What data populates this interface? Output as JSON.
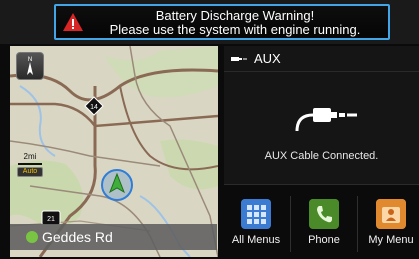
{
  "warning": {
    "line1": "Battery Discharge Warning!",
    "line2": "Please use the system with engine running."
  },
  "map": {
    "route_shield": "14",
    "route_shield_bottom": "21",
    "compass_label": "N",
    "scale": "2mi",
    "scale_mode": "Auto",
    "current_street": "Geddes Rd"
  },
  "aux": {
    "title": "AUX",
    "status": "AUX Cable Connected."
  },
  "shortcuts": [
    {
      "label": "All Menus",
      "icon": "grid-icon"
    },
    {
      "label": "Phone",
      "icon": "phone-icon"
    },
    {
      "label": "My Menu",
      "icon": "my-menu-icon"
    }
  ],
  "colors": {
    "warning_border": "#42a6e6",
    "map_land": "#d8d6c2",
    "map_road": "#8a6a55",
    "car_marker": "#2f7dd8"
  }
}
